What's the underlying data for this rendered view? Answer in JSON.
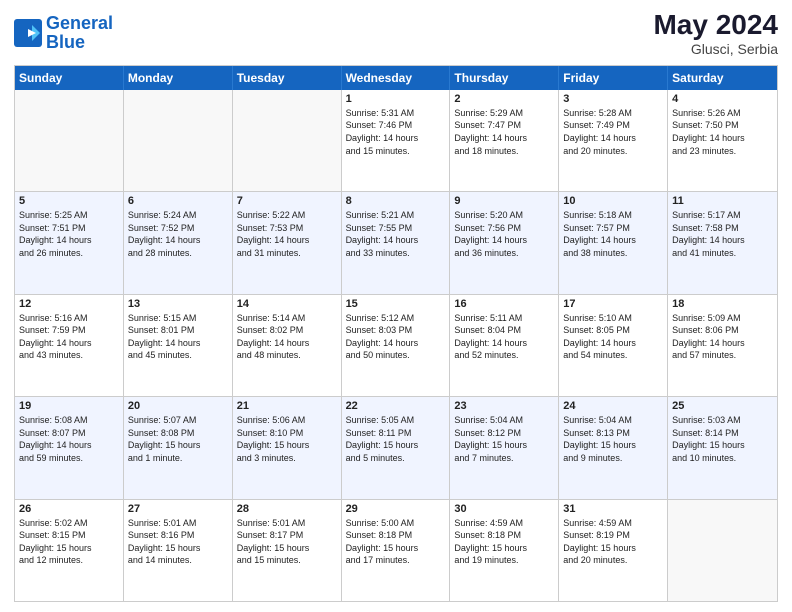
{
  "logo": {
    "line1": "General",
    "line2": "Blue"
  },
  "title": "May 2024",
  "location": "Glusci, Serbia",
  "days_of_week": [
    "Sunday",
    "Monday",
    "Tuesday",
    "Wednesday",
    "Thursday",
    "Friday",
    "Saturday"
  ],
  "rows": [
    [
      {
        "day": "",
        "text": ""
      },
      {
        "day": "",
        "text": ""
      },
      {
        "day": "",
        "text": ""
      },
      {
        "day": "1",
        "text": "Sunrise: 5:31 AM\nSunset: 7:46 PM\nDaylight: 14 hours\nand 15 minutes."
      },
      {
        "day": "2",
        "text": "Sunrise: 5:29 AM\nSunset: 7:47 PM\nDaylight: 14 hours\nand 18 minutes."
      },
      {
        "day": "3",
        "text": "Sunrise: 5:28 AM\nSunset: 7:49 PM\nDaylight: 14 hours\nand 20 minutes."
      },
      {
        "day": "4",
        "text": "Sunrise: 5:26 AM\nSunset: 7:50 PM\nDaylight: 14 hours\nand 23 minutes."
      }
    ],
    [
      {
        "day": "5",
        "text": "Sunrise: 5:25 AM\nSunset: 7:51 PM\nDaylight: 14 hours\nand 26 minutes."
      },
      {
        "day": "6",
        "text": "Sunrise: 5:24 AM\nSunset: 7:52 PM\nDaylight: 14 hours\nand 28 minutes."
      },
      {
        "day": "7",
        "text": "Sunrise: 5:22 AM\nSunset: 7:53 PM\nDaylight: 14 hours\nand 31 minutes."
      },
      {
        "day": "8",
        "text": "Sunrise: 5:21 AM\nSunset: 7:55 PM\nDaylight: 14 hours\nand 33 minutes."
      },
      {
        "day": "9",
        "text": "Sunrise: 5:20 AM\nSunset: 7:56 PM\nDaylight: 14 hours\nand 36 minutes."
      },
      {
        "day": "10",
        "text": "Sunrise: 5:18 AM\nSunset: 7:57 PM\nDaylight: 14 hours\nand 38 minutes."
      },
      {
        "day": "11",
        "text": "Sunrise: 5:17 AM\nSunset: 7:58 PM\nDaylight: 14 hours\nand 41 minutes."
      }
    ],
    [
      {
        "day": "12",
        "text": "Sunrise: 5:16 AM\nSunset: 7:59 PM\nDaylight: 14 hours\nand 43 minutes."
      },
      {
        "day": "13",
        "text": "Sunrise: 5:15 AM\nSunset: 8:01 PM\nDaylight: 14 hours\nand 45 minutes."
      },
      {
        "day": "14",
        "text": "Sunrise: 5:14 AM\nSunset: 8:02 PM\nDaylight: 14 hours\nand 48 minutes."
      },
      {
        "day": "15",
        "text": "Sunrise: 5:12 AM\nSunset: 8:03 PM\nDaylight: 14 hours\nand 50 minutes."
      },
      {
        "day": "16",
        "text": "Sunrise: 5:11 AM\nSunset: 8:04 PM\nDaylight: 14 hours\nand 52 minutes."
      },
      {
        "day": "17",
        "text": "Sunrise: 5:10 AM\nSunset: 8:05 PM\nDaylight: 14 hours\nand 54 minutes."
      },
      {
        "day": "18",
        "text": "Sunrise: 5:09 AM\nSunset: 8:06 PM\nDaylight: 14 hours\nand 57 minutes."
      }
    ],
    [
      {
        "day": "19",
        "text": "Sunrise: 5:08 AM\nSunset: 8:07 PM\nDaylight: 14 hours\nand 59 minutes."
      },
      {
        "day": "20",
        "text": "Sunrise: 5:07 AM\nSunset: 8:08 PM\nDaylight: 15 hours\nand 1 minute."
      },
      {
        "day": "21",
        "text": "Sunrise: 5:06 AM\nSunset: 8:10 PM\nDaylight: 15 hours\nand 3 minutes."
      },
      {
        "day": "22",
        "text": "Sunrise: 5:05 AM\nSunset: 8:11 PM\nDaylight: 15 hours\nand 5 minutes."
      },
      {
        "day": "23",
        "text": "Sunrise: 5:04 AM\nSunset: 8:12 PM\nDaylight: 15 hours\nand 7 minutes."
      },
      {
        "day": "24",
        "text": "Sunrise: 5:04 AM\nSunset: 8:13 PM\nDaylight: 15 hours\nand 9 minutes."
      },
      {
        "day": "25",
        "text": "Sunrise: 5:03 AM\nSunset: 8:14 PM\nDaylight: 15 hours\nand 10 minutes."
      }
    ],
    [
      {
        "day": "26",
        "text": "Sunrise: 5:02 AM\nSunset: 8:15 PM\nDaylight: 15 hours\nand 12 minutes."
      },
      {
        "day": "27",
        "text": "Sunrise: 5:01 AM\nSunset: 8:16 PM\nDaylight: 15 hours\nand 14 minutes."
      },
      {
        "day": "28",
        "text": "Sunrise: 5:01 AM\nSunset: 8:17 PM\nDaylight: 15 hours\nand 15 minutes."
      },
      {
        "day": "29",
        "text": "Sunrise: 5:00 AM\nSunset: 8:18 PM\nDaylight: 15 hours\nand 17 minutes."
      },
      {
        "day": "30",
        "text": "Sunrise: 4:59 AM\nSunset: 8:18 PM\nDaylight: 15 hours\nand 19 minutes."
      },
      {
        "day": "31",
        "text": "Sunrise: 4:59 AM\nSunset: 8:19 PM\nDaylight: 15 hours\nand 20 minutes."
      },
      {
        "day": "",
        "text": ""
      }
    ]
  ]
}
